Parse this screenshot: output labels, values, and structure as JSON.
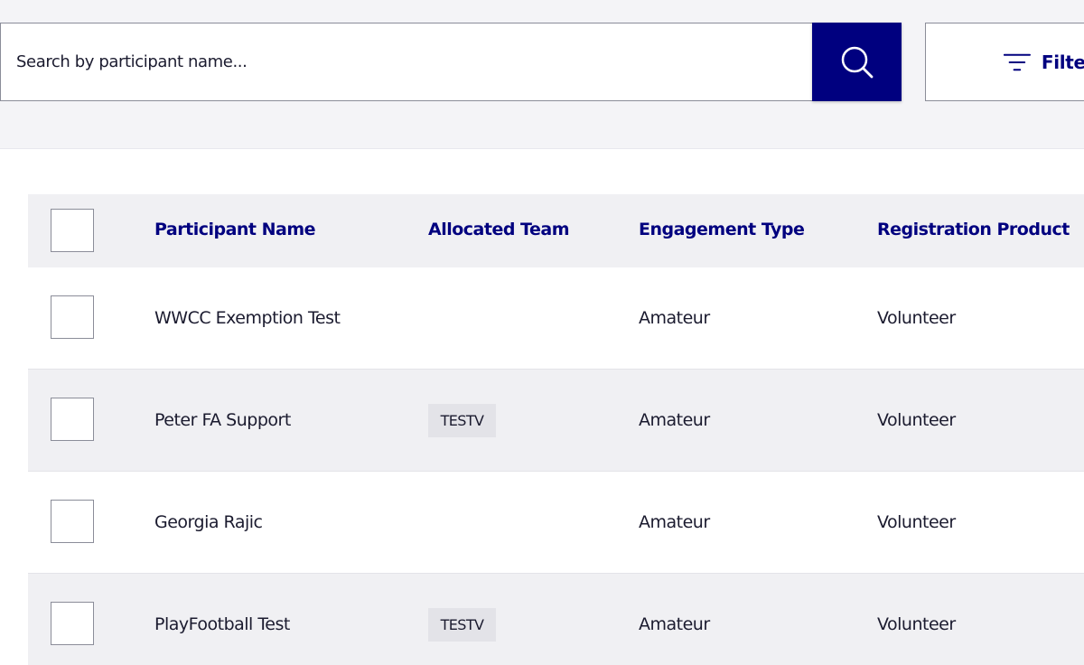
{
  "search": {
    "placeholder": "Search by participant name...",
    "value": ""
  },
  "filter": {
    "label": "Filters"
  },
  "icons": {
    "search": "search-icon",
    "filter": "filter-icon"
  },
  "colors": {
    "accent": "#00007f",
    "row_alt": "#f0f0f3",
    "badge_bg": "#e3e3e8"
  },
  "table": {
    "headers": [
      "Participant Name",
      "Allocated Team",
      "Engagement Type",
      "Registration Product"
    ],
    "rows": [
      {
        "name": "WWCC Exemption Test",
        "team": "",
        "engagement": "Amateur",
        "product": "Volunteer"
      },
      {
        "name": "Peter FA Support",
        "team": "TESTV",
        "engagement": "Amateur",
        "product": "Volunteer"
      },
      {
        "name": "Georgia Rajic",
        "team": "",
        "engagement": "Amateur",
        "product": "Volunteer"
      },
      {
        "name": "PlayFootball Test",
        "team": "TESTV",
        "engagement": "Amateur",
        "product": "Volunteer"
      }
    ]
  }
}
